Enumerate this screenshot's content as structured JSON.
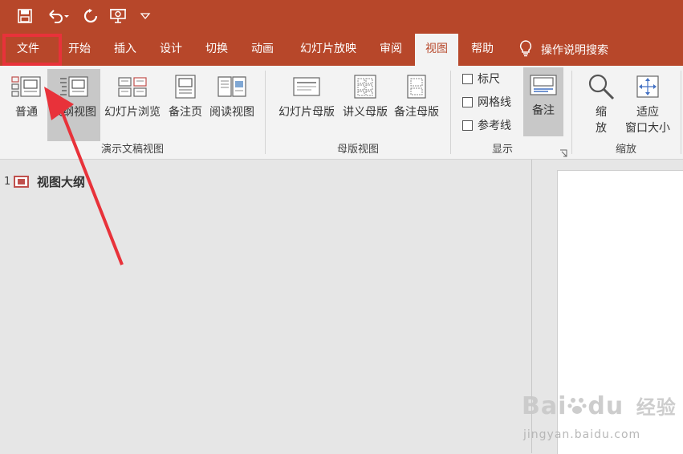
{
  "tabs": [
    {
      "label": "文件",
      "active": false
    },
    {
      "label": "开始",
      "active": false
    },
    {
      "label": "插入",
      "active": false
    },
    {
      "label": "设计",
      "active": false
    },
    {
      "label": "切换",
      "active": false
    },
    {
      "label": "动画",
      "active": false
    },
    {
      "label": "幻灯片放映",
      "active": false
    },
    {
      "label": "审阅",
      "active": false
    },
    {
      "label": "视图",
      "active": true
    },
    {
      "label": "帮助",
      "active": false
    }
  ],
  "search": {
    "label": "操作说明搜索",
    "icon": "lightbulb-icon"
  },
  "quick_access": [
    "save-icon",
    "undo-icon",
    "redo-icon",
    "present-icon",
    "customize-icon"
  ],
  "ribbon": {
    "presentation_views": {
      "label": "演示文稿视图",
      "buttons": [
        {
          "label": "普通",
          "icon": "normal-view-icon"
        },
        {
          "label": "大纲视图",
          "icon": "outline-view-icon",
          "selected": true
        },
        {
          "label": "幻灯片浏览",
          "icon": "slide-sorter-icon"
        },
        {
          "label": "备注页",
          "icon": "notes-page-icon"
        },
        {
          "label": "阅读视图",
          "icon": "reading-view-icon"
        }
      ]
    },
    "master_views": {
      "label": "母版视图",
      "buttons": [
        {
          "label": "幻灯片母版",
          "icon": "slide-master-icon"
        },
        {
          "label": "讲义母版",
          "icon": "handout-master-icon"
        },
        {
          "label": "备注母版",
          "icon": "notes-master-icon"
        }
      ]
    },
    "show": {
      "label": "显示",
      "checkboxes": [
        {
          "label": "标尺",
          "checked": false
        },
        {
          "label": "网格线",
          "checked": false
        },
        {
          "label": "参考线",
          "checked": false
        }
      ],
      "notes_button": {
        "label": "备注",
        "selected": true
      }
    },
    "zoom": {
      "label": "缩放",
      "buttons": [
        {
          "label_line1": "缩",
          "label_line2": "放",
          "icon": "zoom-icon"
        },
        {
          "label_line1": "适应",
          "label_line2": "窗口大小",
          "icon": "fit-window-icon"
        }
      ]
    }
  },
  "outline": {
    "slide_number": "1",
    "title": "视图大纲"
  },
  "watermark": {
    "brand_left": "Bai",
    "brand_right": "du",
    "brand_cn": "经验",
    "url": "jingyan.baidu.com"
  },
  "colors": {
    "accent": "#b7472a",
    "annotation": "#e8323a"
  }
}
